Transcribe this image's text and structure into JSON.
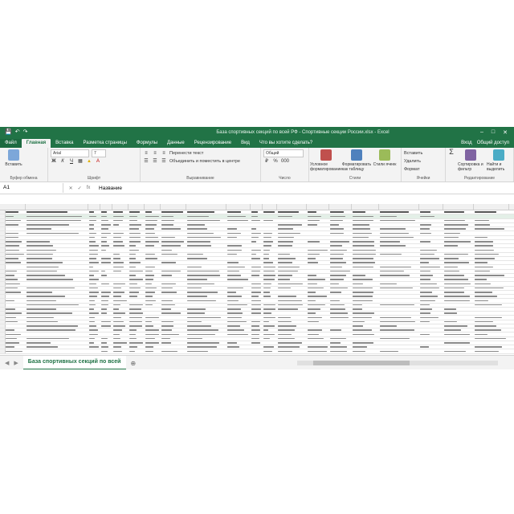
{
  "window": {
    "title": "База спортивных секций по всей РФ - Спортивные секции России.xlsx - Excel",
    "controls": [
      "–",
      "□",
      "✕"
    ]
  },
  "qat": {
    "save": "💾",
    "undo": "↶",
    "redo": "↷"
  },
  "tabs": [
    {
      "label": "Файл"
    },
    {
      "label": "Главная"
    },
    {
      "label": "Вставка"
    },
    {
      "label": "Разметка страницы"
    },
    {
      "label": "Формулы"
    },
    {
      "label": "Данные"
    },
    {
      "label": "Рецензирование"
    },
    {
      "label": "Вид"
    },
    {
      "label": "Что вы хотите сделать?"
    }
  ],
  "tabs_right": {
    "signin": "Вход",
    "share": "Общий доступ"
  },
  "ribbon": {
    "clipboard": {
      "paste": "Вставить",
      "label": "Буфер обмена"
    },
    "font": {
      "name": "Arial",
      "size": "7",
      "label": "Шрифт"
    },
    "alignment": {
      "wrap": "Перенести текст",
      "merge": "Объединить и поместить в центре",
      "label": "Выравнивание"
    },
    "number": {
      "format": "Общий",
      "label": "Число"
    },
    "styles": {
      "cond": "Условное форматирование",
      "table": "Форматировать как таблицу",
      "cell": "Стили ячеек",
      "label": "Стили"
    },
    "cells": {
      "insert": "Вставить",
      "delete": "Удалить",
      "format": "Формат",
      "label": "Ячейки"
    },
    "editing": {
      "sort": "Сортировка и фильтр",
      "find": "Найти и выделить",
      "label": "Редактирование"
    }
  },
  "formula_bar": {
    "cell": "A1",
    "fx": "fx",
    "value": "Название"
  },
  "sheet": {
    "tab": "База спортивных секций по всей"
  }
}
